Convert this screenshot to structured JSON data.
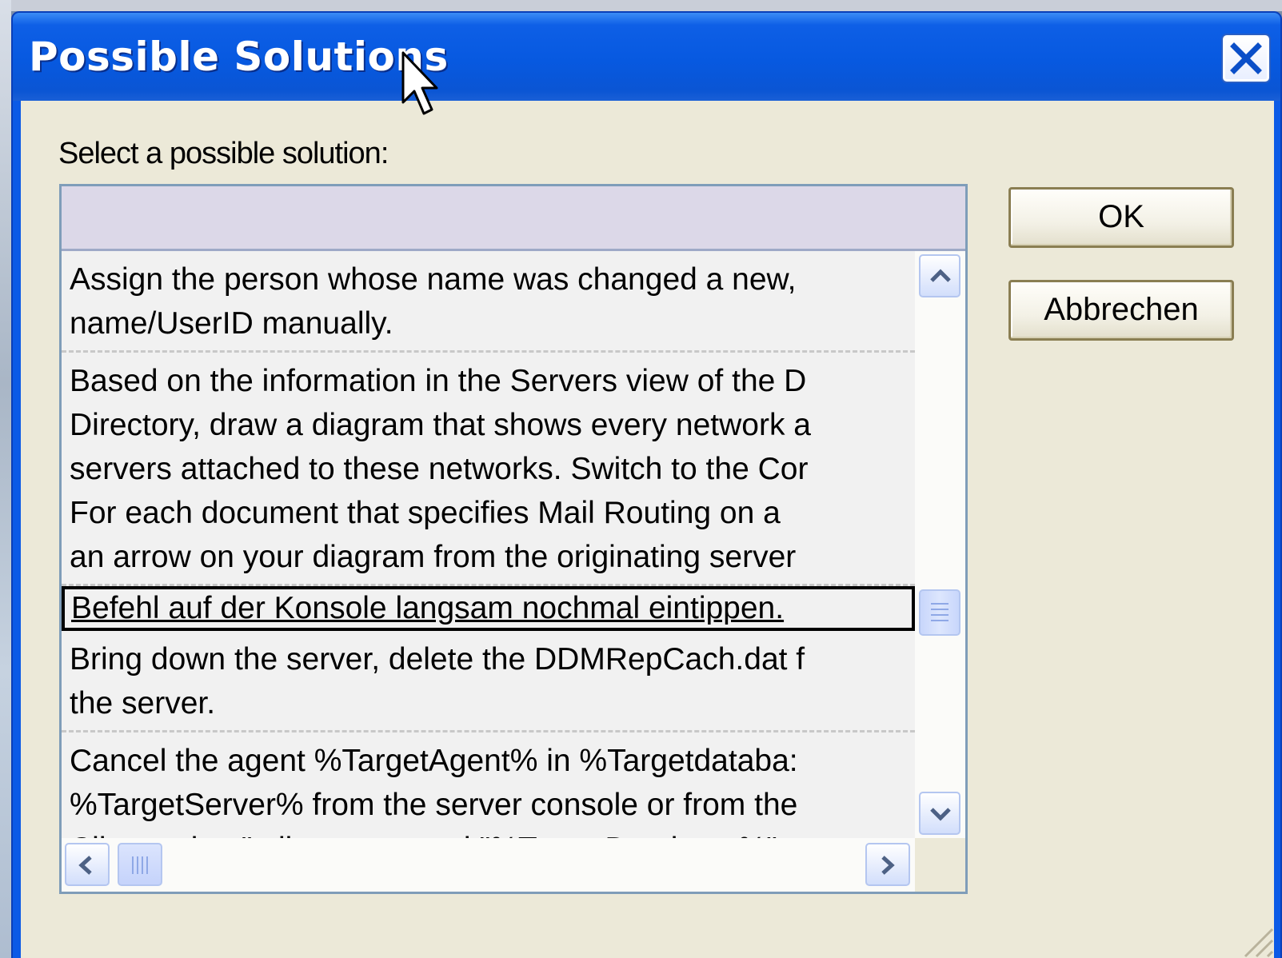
{
  "window": {
    "title": "Possible Solutions",
    "close_icon": "close-icon"
  },
  "prompt_label": "Select a possible solution:",
  "list": {
    "selected_index": 2,
    "items": [
      {
        "lines": [
          "Assign the person whose name was changed a new,",
          "name/UserID manually."
        ]
      },
      {
        "lines": [
          "Based on the information in the Servers view of the D",
          "Directory, draw a diagram that shows every network a",
          "servers attached to these networks. Switch to the Cor",
          "For each document that specifies Mail Routing on a",
          "an arrow on your diagram from the originating server"
        ]
      },
      {
        "lines": [
          "Befehl auf der Konsole langsam nochmal eintippen."
        ]
      },
      {
        "lines": [
          "Bring down the server, delete the DDMRepCach.dat f",
          "the server."
        ]
      },
      {
        "lines": [
          "Cancel the agent %TargetAgent% in %Targetdataba:",
          "%TargetServer% from the server console or from the",
          "Client using \"tell amgr cancel \"%TargetDatabase%\""
        ]
      }
    ]
  },
  "buttons": {
    "ok_label": "OK",
    "cancel_label": "Abbrechen"
  },
  "colors": {
    "titlebar": "#0b5ae6",
    "client_background": "#ece9d8",
    "list_header": "#dcd8e8"
  }
}
